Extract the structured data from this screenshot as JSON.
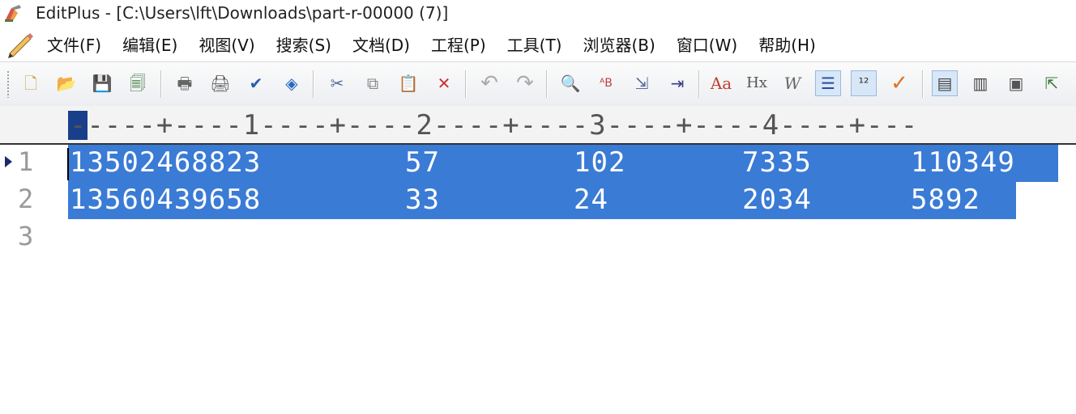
{
  "window": {
    "title": "EditPlus - [C:\\Users\\lft\\Downloads\\part-r-00000 (7)]",
    "app_icon": "editplus-quill-icon"
  },
  "menu": {
    "items": [
      "文件(F)",
      "编辑(E)",
      "视图(V)",
      "搜索(S)",
      "文档(D)",
      "工程(P)",
      "工具(T)",
      "浏览器(B)",
      "窗口(W)",
      "帮助(H)"
    ]
  },
  "toolbar": {
    "buttons": [
      {
        "name": "new-file-icon",
        "glyph": "🗋"
      },
      {
        "name": "open-folder-icon",
        "glyph": "📂"
      },
      {
        "name": "save-icon",
        "glyph": "💾"
      },
      {
        "name": "save-all-icon",
        "glyph": "🗐"
      },
      {
        "name": "print-preview-icon",
        "glyph": "🖶"
      },
      {
        "name": "print-icon",
        "glyph": "🖨"
      },
      {
        "name": "spellcheck-icon",
        "glyph": "✔"
      },
      {
        "name": "browser-preview-icon",
        "glyph": "◈"
      },
      {
        "name": "cut-icon",
        "glyph": "✂"
      },
      {
        "name": "copy-icon",
        "glyph": "⧉"
      },
      {
        "name": "paste-icon",
        "glyph": "📋"
      },
      {
        "name": "delete-icon",
        "glyph": "✕"
      },
      {
        "name": "undo-icon",
        "glyph": "↶"
      },
      {
        "name": "redo-icon",
        "glyph": "↷"
      },
      {
        "name": "find-icon",
        "glyph": "🔍"
      },
      {
        "name": "replace-icon",
        "glyph": "ᴬB"
      },
      {
        "name": "goto-icon",
        "glyph": "⇲"
      },
      {
        "name": "indent-icon",
        "glyph": "⇥"
      },
      {
        "name": "font-icon",
        "glyph": "Aa"
      },
      {
        "name": "html-heading-icon",
        "glyph": "Hx"
      },
      {
        "name": "word-wrap-icon",
        "glyph": "W"
      },
      {
        "name": "line-numbers-toggle-icon",
        "glyph": "☰"
      },
      {
        "name": "column-select-icon",
        "glyph": "¹²"
      },
      {
        "name": "check-icon",
        "glyph": "✓"
      },
      {
        "name": "directory-window-icon",
        "glyph": "▤"
      },
      {
        "name": "cliptext-window-icon",
        "glyph": "▥"
      },
      {
        "name": "output-window-icon",
        "glyph": "▣"
      },
      {
        "name": "fullscreen-icon",
        "glyph": "⇱"
      }
    ]
  },
  "ruler": {
    "text": "-----+----1----+----2----+----3----+----4----+---"
  },
  "editor": {
    "line_numbers": [
      "1",
      "2",
      "3"
    ],
    "selection_color": "#3a7bd5",
    "rows": [
      [
        "13502468823",
        "57",
        "102",
        "7335",
        "110349"
      ],
      [
        "13560439658",
        "33",
        "24",
        "2034",
        "5892"
      ]
    ]
  }
}
